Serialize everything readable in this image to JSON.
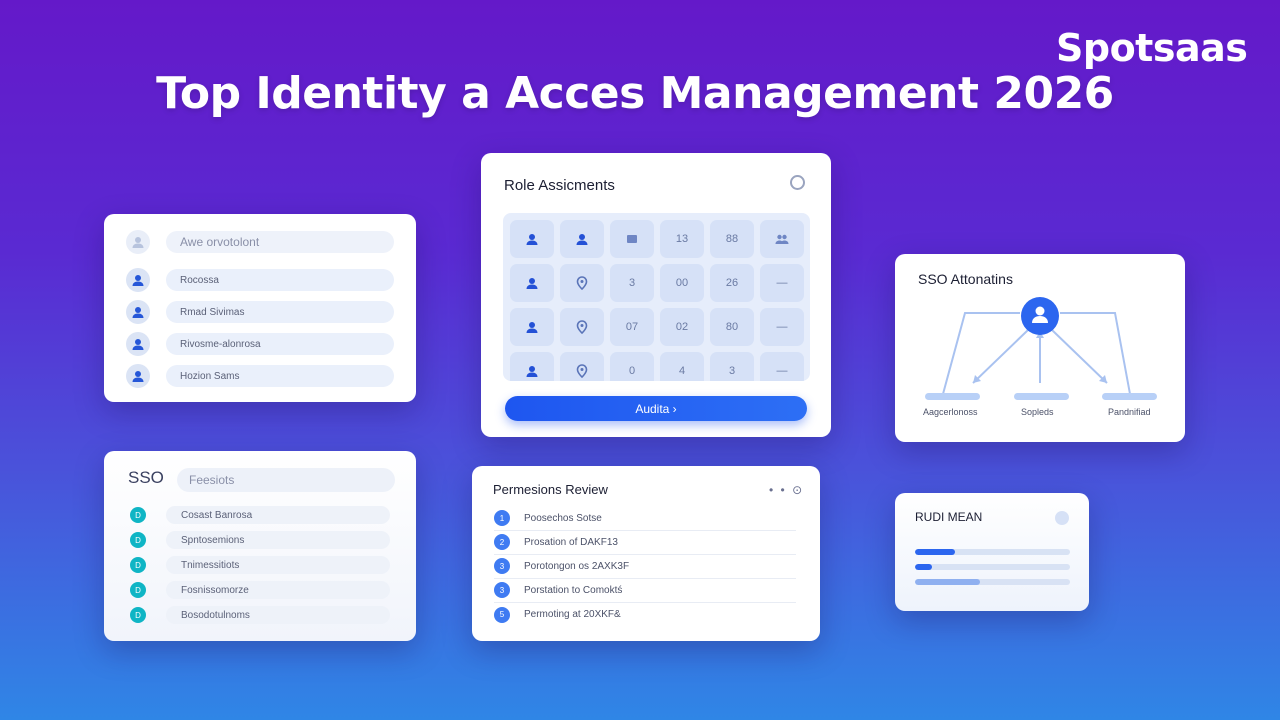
{
  "brand": "Spotsaas",
  "headline": "Top Identity a Acces Management 2026",
  "users_card": {
    "search_placeholder": "Awe orvotolont",
    "users": [
      "Rocossa",
      "Rmad Sivimas",
      "Rivosme-alonrosa",
      "Hozion Sams"
    ]
  },
  "roles_card": {
    "title": "Role Assicments",
    "cells": [
      "user-icon",
      "user-icon",
      "square-icon",
      "13",
      "88",
      "people-icon",
      "user-icon",
      "pin-icon",
      "3",
      "00",
      "26",
      "—",
      "user-icon",
      "pin-icon",
      "07",
      "02",
      "80",
      "—",
      "user-icon",
      "pin-icon",
      "0",
      "4",
      "3",
      "—"
    ],
    "audit_button": "Audita ›"
  },
  "sso_auth_card": {
    "title": "SSO Attonatins",
    "labels": [
      "Aagcerlonoss",
      "Sopleds",
      "Pandnifiad"
    ]
  },
  "sso_sessions_card": {
    "title": "SSO",
    "search_placeholder": "Feesiots",
    "rows": [
      "Cosast Banrosa",
      "Spntosemions",
      "Tnimessitiots",
      "Fosnissomorze",
      "Bosodotulnoms"
    ],
    "row_badge": "D"
  },
  "permissions_card": {
    "title": "Permesions Review",
    "menu": "• • ⊙",
    "rows": [
      {
        "num": "1",
        "text": "Poosechos Sotse"
      },
      {
        "num": "2",
        "text": "Prosation of DAKF13"
      },
      {
        "num": "3",
        "text": "Porotongon os 2AXK3F"
      },
      {
        "num": "3",
        "text": "Porstation to Comoktś"
      },
      {
        "num": "5",
        "text": "Permoting at 20XKF&"
      }
    ]
  },
  "rudi_card": {
    "title": "RUDI MEAN",
    "bars": [
      0.26,
      0.11,
      0.42
    ]
  },
  "colors": {
    "accent": "#2c66ef",
    "teal": "#0fb5c5"
  }
}
